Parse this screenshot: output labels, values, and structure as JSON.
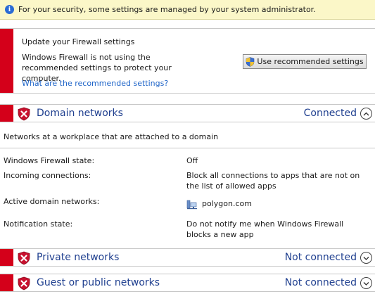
{
  "infobar": {
    "text": "For your security, some settings are managed by your system administrator.",
    "icon": "info-icon"
  },
  "alert": {
    "title": "Update your Firewall settings",
    "description": "Windows Firewall is not using the recommended settings to protect your computer.",
    "button_label": "Use recommended settings",
    "link_text": "What are the recommended settings?"
  },
  "domain": {
    "title": "Domain networks",
    "status": "Connected",
    "description": "Networks at a workplace that are attached to a domain",
    "properties": [
      {
        "label": "Windows Firewall state:",
        "value": "Off"
      },
      {
        "label": "Incoming connections:",
        "value": "Block all connections to apps that are not on the list of allowed apps"
      },
      {
        "label": "Active domain networks:",
        "value": "polygon.com"
      },
      {
        "label": "Notification state:",
        "value": "Do not notify me when Windows Firewall blocks a new app"
      }
    ]
  },
  "private": {
    "title": "Private networks",
    "status": "Not connected"
  },
  "public": {
    "title": "Guest or public networks",
    "status": "Not connected"
  },
  "colors": {
    "alert_red": "#d4001a",
    "header_blue": "#1f3f8f",
    "link_blue": "#1e64c8",
    "infobar_yellow": "#fbf7c8"
  }
}
